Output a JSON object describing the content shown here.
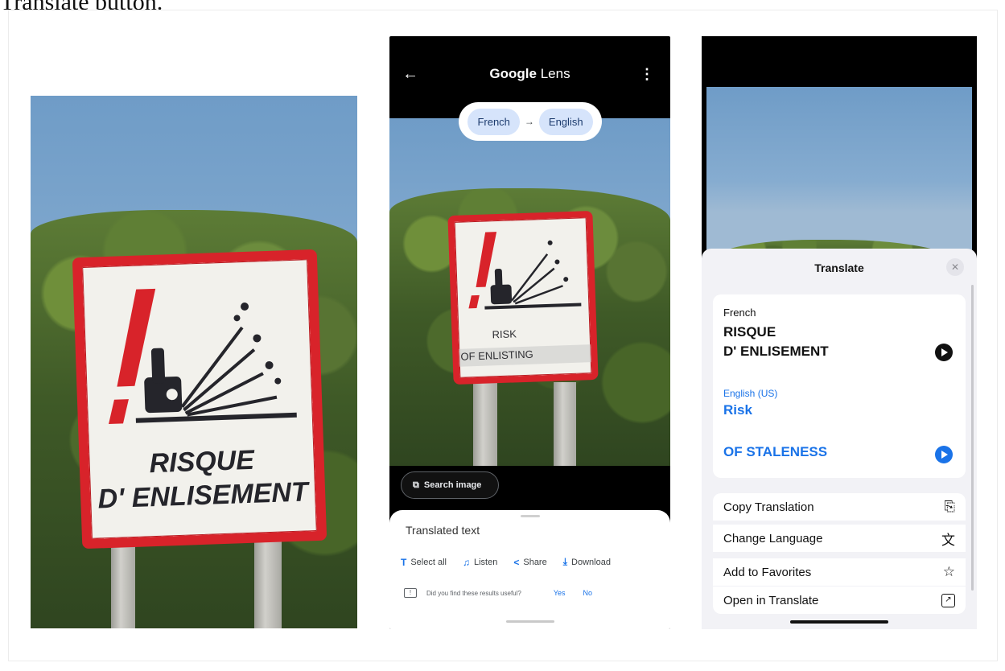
{
  "caption": "Translate button.",
  "lens": {
    "title_bold": "Google",
    "title_rest": " Lens",
    "source_lang": "French",
    "target_lang": "English",
    "overlay_line1": "RISK",
    "overlay_line2": "OF ENLISTING",
    "search_image": "Search image",
    "sheet_title": "Translated text",
    "actions": [
      "Select all",
      "Listen",
      "Share",
      "Download"
    ],
    "feedback_question": "Did you find these results useful?",
    "feedback_yes": "Yes",
    "feedback_no": "No"
  },
  "sign": {
    "line1": "RISQUE",
    "line2": "D' ENLISEMENT"
  },
  "translate": {
    "title": "Translate",
    "close": "✕",
    "source_lang": "French",
    "source_line1": "RISQUE",
    "source_line2": "D' ENLISEMENT",
    "target_lang": "English (US)",
    "target_line1": "Risk",
    "target_line2": "OF STALENESS",
    "menu": [
      "Copy Translation",
      "Change Language",
      "Add to Favorites",
      "Open in Translate"
    ]
  },
  "colors": {
    "accent": "#1a73e8",
    "sign_red": "#d8232a",
    "chip_bg": "#d6e4fb"
  },
  "icons": [
    "back-arrow-icon",
    "more-vert-icon",
    "arrow-right-icon",
    "image-search-icon",
    "text-select-icon",
    "listen-icon",
    "share-icon",
    "download-icon",
    "feedback-icon",
    "close-icon",
    "play-icon",
    "copy-icon",
    "translate-icon",
    "star-icon",
    "open-external-icon"
  ]
}
